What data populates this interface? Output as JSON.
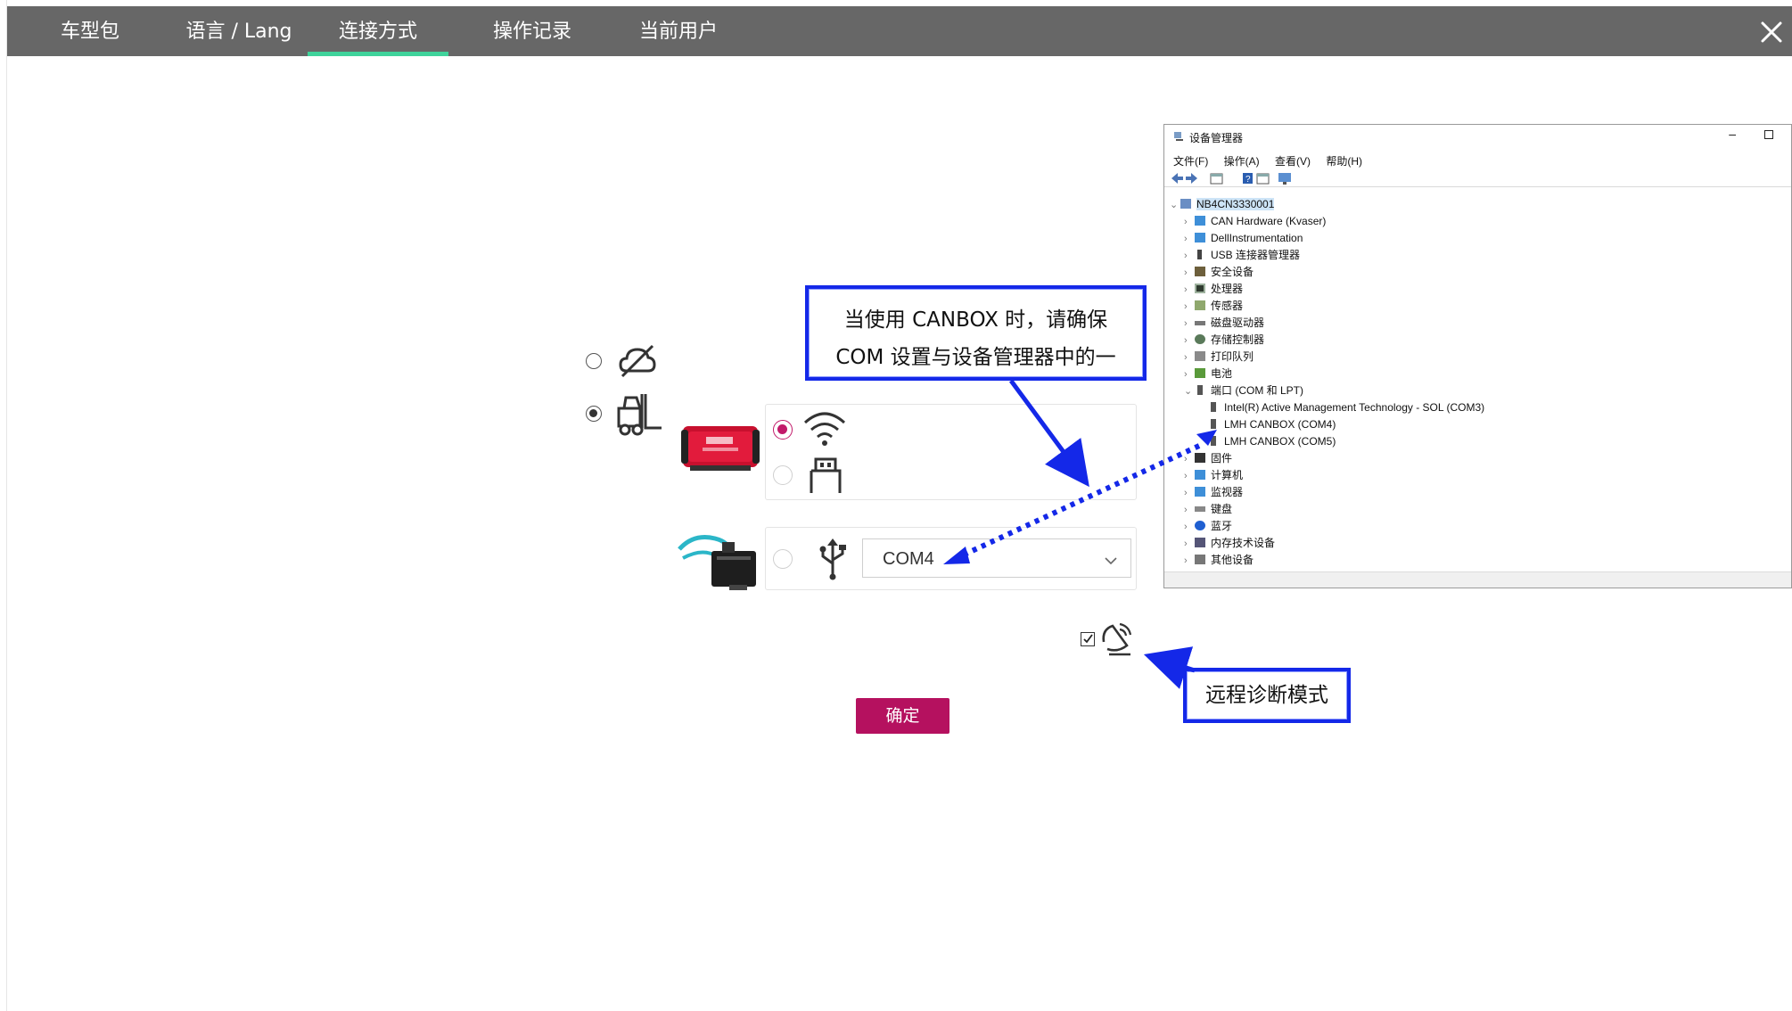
{
  "tabs": [
    {
      "label": "车型包",
      "active": false
    },
    {
      "label": "语言 / Lang",
      "active": false
    },
    {
      "label": "连接方式",
      "active": true
    },
    {
      "label": "操作记录",
      "active": false
    },
    {
      "label": "当前用户",
      "active": false
    }
  ],
  "colors": {
    "topbar": "#676767",
    "tab_active": "#3fd39b",
    "accent": "#b5115f",
    "callout_border": "#1428e8",
    "arrow": "#1428e8"
  },
  "connection": {
    "mode_options": [
      {
        "icon": "offline-icon",
        "selected": false
      },
      {
        "icon": "forklift-icon",
        "selected": true
      }
    ],
    "vci_options": [
      {
        "icon": "wifi-icon",
        "selected": true
      },
      {
        "icon": "usb-plug-icon",
        "selected": false
      }
    ],
    "canbox": {
      "icon": "usb-icon",
      "selected": false,
      "port_value": "COM4"
    },
    "remote_diagnosis_checked": true,
    "ok_label": "确定"
  },
  "callouts": {
    "com_line1": "当使用 CANBOX 时，请确保",
    "com_line2": "COM 设置与设备管理器中的一",
    "remote": "远程诊断模式"
  },
  "device_manager": {
    "title": "设备管理器",
    "menu": [
      "文件(F)",
      "操作(A)",
      "查看(V)",
      "帮助(H)"
    ],
    "root": "NB4CN3330001",
    "items": [
      "CAN Hardware (Kvaser)",
      "DellInstrumentation",
      "USB 连接器管理器",
      "安全设备",
      "处理器",
      "传感器",
      "磁盘驱动器",
      "存储控制器",
      "打印队列",
      "电池",
      "端口 (COM 和 LPT)",
      "Intel(R) Active Management Technology - SOL (COM3)",
      "LMH CANBOX (COM4)",
      "LMH CANBOX (COM5)",
      "固件",
      "计算机",
      "监视器",
      "键盘",
      "蓝牙",
      "内存技术设备",
      "其他设备"
    ]
  }
}
